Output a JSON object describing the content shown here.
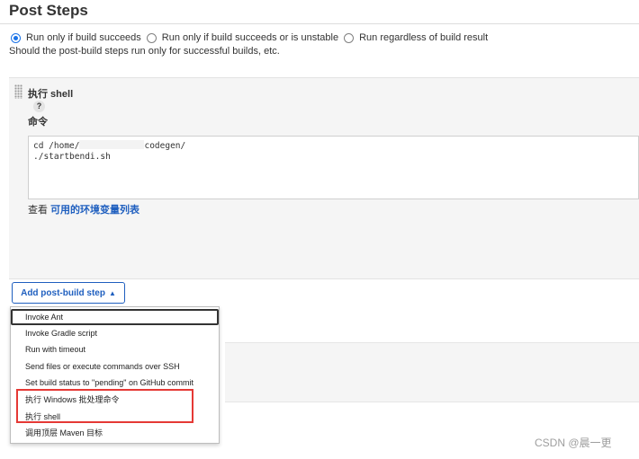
{
  "section": {
    "title": "Post Steps"
  },
  "radio_options": [
    {
      "label": "Run only if build succeeds",
      "checked": true
    },
    {
      "label": "Run only if build succeeds or is unstable",
      "checked": false
    },
    {
      "label": "Run regardless of build result",
      "checked": false
    }
  ],
  "radio_description": "Should the post-build steps run only for successful builds, etc.",
  "step": {
    "title": "执行 shell",
    "help": "?",
    "command_label": "命令",
    "command_line1_a": "cd /home/",
    "command_line1_b": "codegen/",
    "command_line2": "./startbendi.sh",
    "env_prefix": "查看 ",
    "env_link": "可用的环境变量列表"
  },
  "add_button": {
    "label": "Add post-build step",
    "caret": "▲"
  },
  "menu_items": [
    "Invoke Ant",
    "Invoke Gradle script",
    "Run with timeout",
    "Send files or execute commands over SSH",
    "Set build status to \"pending\" on GitHub commit",
    "执行 Windows 批处理命令",
    "执行 shell",
    "调用顶层 Maven 目标"
  ],
  "watermark": "CSDN @晨一更",
  "colors": {
    "accent": "#1f5fbf",
    "radio": "#1a73e8",
    "highlight": "#e53935"
  }
}
